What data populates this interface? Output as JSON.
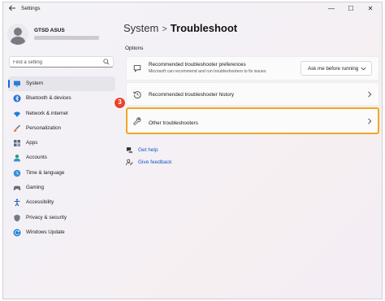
{
  "window": {
    "app_title": "Settings",
    "controls": {
      "minimize": "—",
      "maximize": "☐",
      "close": "✕"
    }
  },
  "profile": {
    "name": "GTSD ASUS"
  },
  "search": {
    "placeholder": "Find a setting"
  },
  "sidebar": {
    "items": [
      {
        "label": "System",
        "icon": "system-icon",
        "selected": true
      },
      {
        "label": "Bluetooth & devices",
        "icon": "bluetooth-icon"
      },
      {
        "label": "Network & internet",
        "icon": "wifi-icon"
      },
      {
        "label": "Personalization",
        "icon": "brush-icon"
      },
      {
        "label": "Apps",
        "icon": "apps-icon"
      },
      {
        "label": "Accounts",
        "icon": "accounts-icon"
      },
      {
        "label": "Time & language",
        "icon": "globe-clock-icon"
      },
      {
        "label": "Gaming",
        "icon": "gamepad-icon"
      },
      {
        "label": "Accessibility",
        "icon": "accessibility-icon"
      },
      {
        "label": "Privacy & security",
        "icon": "shield-icon"
      },
      {
        "label": "Windows Update",
        "icon": "windows-update-icon"
      }
    ]
  },
  "header": {
    "parent": "System",
    "separator": ">",
    "current": "Troubleshoot"
  },
  "main": {
    "section_label": "Options",
    "cards": [
      {
        "title": "Recommended troubleshooter preferences",
        "description": "Microsoft can recommend and run troubleshooters to fix issues",
        "dropdown_value": "Ask me before running"
      },
      {
        "title": "Recommended troubleshooter history"
      },
      {
        "title": "Other troubleshooters"
      }
    ],
    "step_badge": "3",
    "links": {
      "help": "Get help",
      "feedback": "Give feedback"
    }
  },
  "colors": {
    "accent": "#1a64d6",
    "highlight_border": "#f1a728",
    "step_badge": "#e8442e",
    "link": "#1557c0"
  }
}
